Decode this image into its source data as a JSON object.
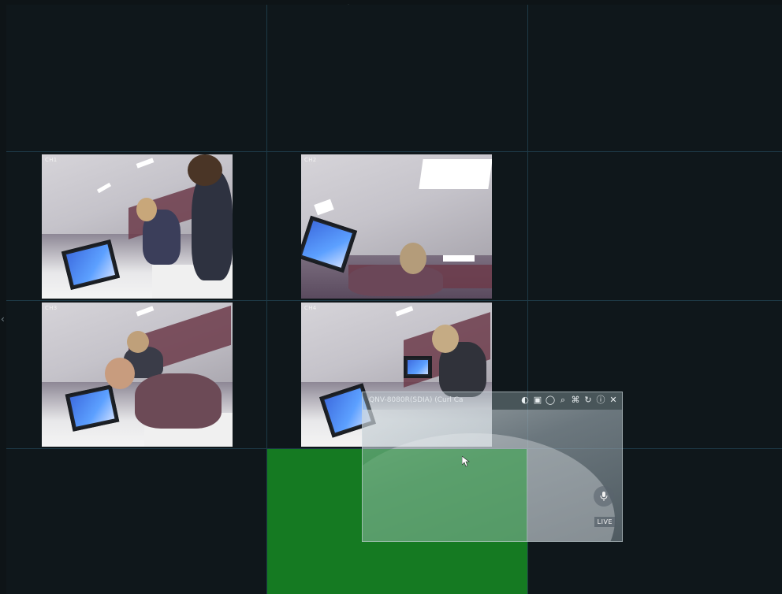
{
  "window": {
    "top_handle_icon": "chevron-up-icon",
    "left_handle_icon": "chevron-left-icon",
    "bottom_handle_icon": "chevron-down-icon"
  },
  "grid": {
    "columns": 3,
    "rows": 4,
    "line_color": "#1e3a47",
    "background": "#0f171b",
    "highlight_color": "#157a22"
  },
  "cameras": [
    {
      "id": "cam-1",
      "label": "CH1"
    },
    {
      "id": "cam-2",
      "label": "CH2"
    },
    {
      "id": "cam-3",
      "label": "CH3"
    },
    {
      "id": "cam-4",
      "label": "CH4"
    }
  ],
  "floating_viewer": {
    "title": "QNV-8080R(SDIA) (Curl Ca",
    "toolbar": [
      {
        "name": "contrast-icon",
        "glyph": "◐",
        "tooltip": ""
      },
      {
        "name": "picture-in-picture-icon",
        "glyph": "▣",
        "tooltip": ""
      },
      {
        "name": "record-icon",
        "glyph": "◯",
        "tooltip": ""
      },
      {
        "name": "zoom-icon",
        "glyph": "⌕",
        "tooltip": ""
      },
      {
        "name": "fisheye-icon",
        "glyph": "⌘",
        "tooltip": ""
      },
      {
        "name": "rotate-icon",
        "glyph": "↻",
        "tooltip": ""
      },
      {
        "name": "info-icon",
        "glyph": "ⓘ",
        "tooltip": ""
      },
      {
        "name": "close-icon",
        "glyph": "✕",
        "tooltip": ""
      }
    ],
    "mic_icon": "microphone-icon",
    "live_label": "LIVE"
  }
}
